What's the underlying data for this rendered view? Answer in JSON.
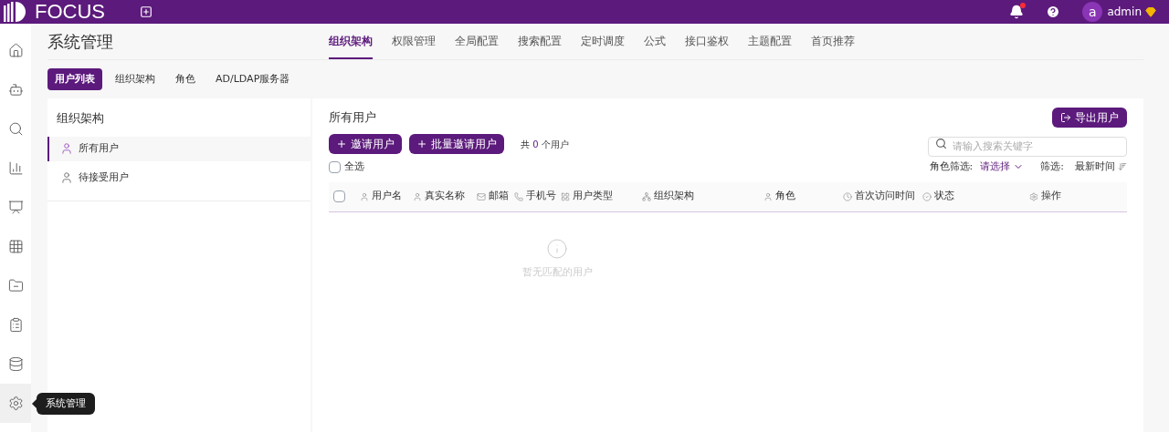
{
  "top_bar": {
    "logo": "FOCUS",
    "user_initial": "a",
    "user_name": "admin",
    "has_notification": true
  },
  "sidebar": {
    "items": [
      {
        "kind": "home",
        "selected": false
      },
      {
        "kind": "robot",
        "selected": false
      },
      {
        "kind": "search",
        "selected": false
      },
      {
        "kind": "chart",
        "selected": false
      },
      {
        "kind": "presentation",
        "selected": false
      },
      {
        "kind": "table",
        "selected": false
      },
      {
        "kind": "folder",
        "selected": false
      },
      {
        "kind": "clipboard",
        "selected": false
      },
      {
        "kind": "database",
        "selected": false
      },
      {
        "kind": "settings",
        "selected": true
      }
    ],
    "tooltip": "系统管理"
  },
  "page_title": "系统管理",
  "tabs": [
    {
      "label": "组织架构",
      "selected": true
    },
    {
      "label": "权限管理",
      "selected": false
    },
    {
      "label": "全局配置",
      "selected": false
    },
    {
      "label": "搜索配置",
      "selected": false
    },
    {
      "label": "定时调度",
      "selected": false
    },
    {
      "label": "公式",
      "selected": false
    },
    {
      "label": "接口鉴权",
      "selected": false
    },
    {
      "label": "主题配置",
      "selected": false
    },
    {
      "label": "首页推荐",
      "selected": false
    }
  ],
  "sub_tabs": [
    {
      "label": "用户列表",
      "selected": true
    },
    {
      "label": "组织架构",
      "selected": false
    },
    {
      "label": "角色",
      "selected": false
    },
    {
      "label": "AD/LDAP服务器",
      "selected": false
    }
  ],
  "org_panel": {
    "title": "组织架构",
    "items": [
      {
        "label": "所有用户",
        "selected": true
      },
      {
        "label": "待接受用户",
        "selected": false
      }
    ]
  },
  "users_panel": {
    "title": "所有用户",
    "export_button": "导出用户",
    "invite_button": "邀请用户",
    "batch_invite_button": "批量邀请用户",
    "count_prefix": "共",
    "count": "0",
    "count_suffix": "个用户",
    "search": {
      "placeholder": "请输入搜索关键字"
    },
    "select_all": {
      "label": "全选",
      "checked": false
    },
    "role_filter_label": "角色筛选:",
    "role_filter_value": "请选择",
    "sort_label": "筛选:",
    "sort_value": "最新时间",
    "table": {
      "header_checked": false,
      "columns": [
        {
          "label": "用户名",
          "kind": "user"
        },
        {
          "label": "真实名称",
          "kind": "user"
        },
        {
          "label": "邮箱",
          "kind": "mail"
        },
        {
          "label": "手机号",
          "kind": "phone"
        },
        {
          "label": "用户类型",
          "kind": "grid"
        },
        {
          "label": "组织架构",
          "kind": "org"
        },
        {
          "label": "角色",
          "kind": "user"
        },
        {
          "label": "首次访问时间",
          "kind": "clock"
        },
        {
          "label": "状态",
          "kind": "check"
        },
        {
          "label": "操作",
          "kind": "gear"
        }
      ],
      "empty_text": "暂无匹配的用户"
    }
  }
}
